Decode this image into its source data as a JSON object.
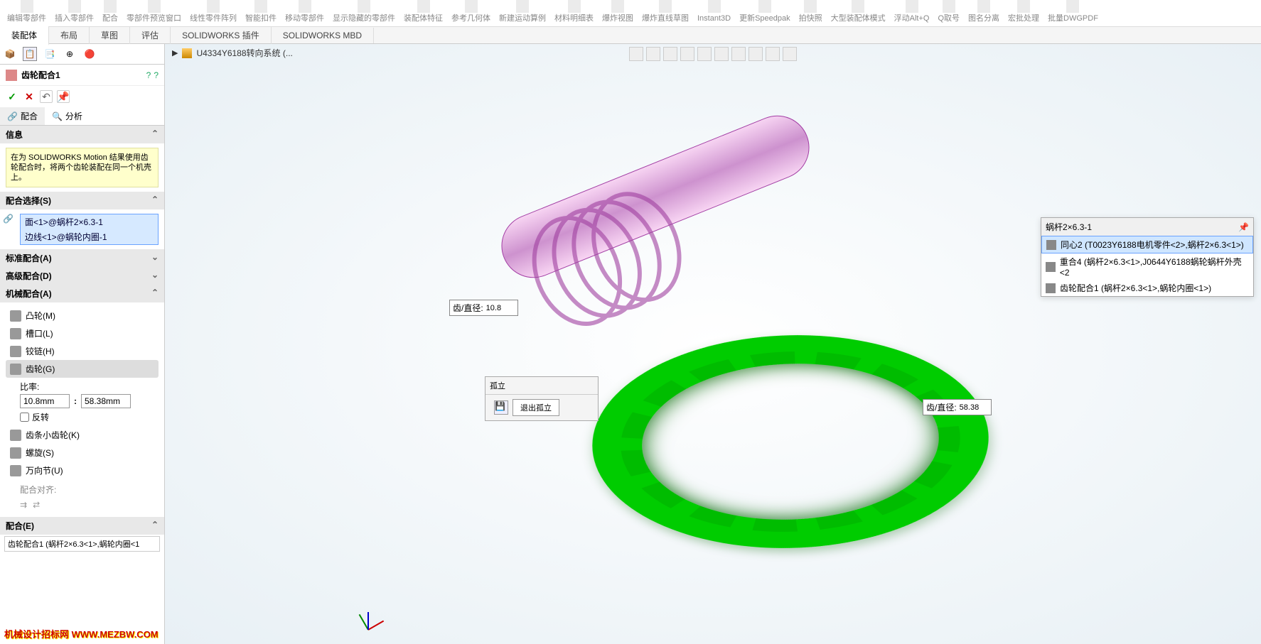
{
  "ribbon": {
    "items": [
      "编辑零部件",
      "插入零部件",
      "配合",
      "零部件预览窗口",
      "线性零件阵列",
      "智能扣件",
      "移动零部件",
      "显示隐藏的零部件",
      "装配体特征",
      "参考几何体",
      "新建运动算例",
      "材料明细表",
      "爆炸视图",
      "爆炸直线草图",
      "Instant3D",
      "更新Speedpak",
      "拍快照",
      "大型装配体模式",
      "浮动Alt+Q",
      "Q取号",
      "图名分离",
      "宏批处理",
      "批量DWGPDF"
    ]
  },
  "tabs": [
    "装配体",
    "布局",
    "草图",
    "评估",
    "SOLIDWORKS 插件",
    "SOLIDWORKS MBD"
  ],
  "active_tab": 0,
  "crumb": "U4334Y6188转向系统 (...",
  "feature": {
    "name": "齿轮配合1",
    "subtab_mate": "配合",
    "subtab_analysis": "分析"
  },
  "sect_info": {
    "title": "信息",
    "body": "在为 SOLIDWORKS Motion 结果使用齿轮配合时，将两个齿轮装配在同一个机壳上。"
  },
  "sect_sel": {
    "title": "配合选择(S)",
    "rows": [
      "面<1>@蜗杆2×6.3-1",
      "边线<1>@蜗轮内圈-1"
    ]
  },
  "sect_std": "标准配合(A)",
  "sect_adv": "高级配合(D)",
  "sect_mech": {
    "title": "机械配合(A)",
    "items": [
      "凸轮(M)",
      "槽口(L)",
      "铰链(H)",
      "齿轮(G)",
      "齿条小齿轮(K)",
      "螺旋(S)",
      "万向节(U)"
    ],
    "active": 3,
    "ratio_label": "比率:",
    "ratio1": "10.8mm",
    "ratio2": "58.38mm",
    "reverse": "反转",
    "align": "配合对齐:"
  },
  "sect_mates": {
    "title": "配合(E)",
    "row": "齿轮配合1 (蜗杆2×6.3<1>,蜗轮内圈<1"
  },
  "callout1": {
    "label": "齿/直径:",
    "value": "10.8"
  },
  "callout2": {
    "label": "齿/直径:",
    "value": "58.38"
  },
  "iso": {
    "title": "孤立",
    "exit": "退出孤立"
  },
  "float": {
    "title": "蜗杆2×6.3-1",
    "rows": [
      "同心2 (T0023Y6188电机零件<2>,蜗杆2×6.3<1>)",
      "重合4 (蜗杆2×6.3<1>,J0644Y6188蜗轮蜗杆外壳<2",
      "齿轮配合1 (蜗杆2×6.3<1>,蜗轮内圈<1>)"
    ],
    "sel": 0
  },
  "watermark": "机械设计招标网\nWWW.MEZBW.COM"
}
